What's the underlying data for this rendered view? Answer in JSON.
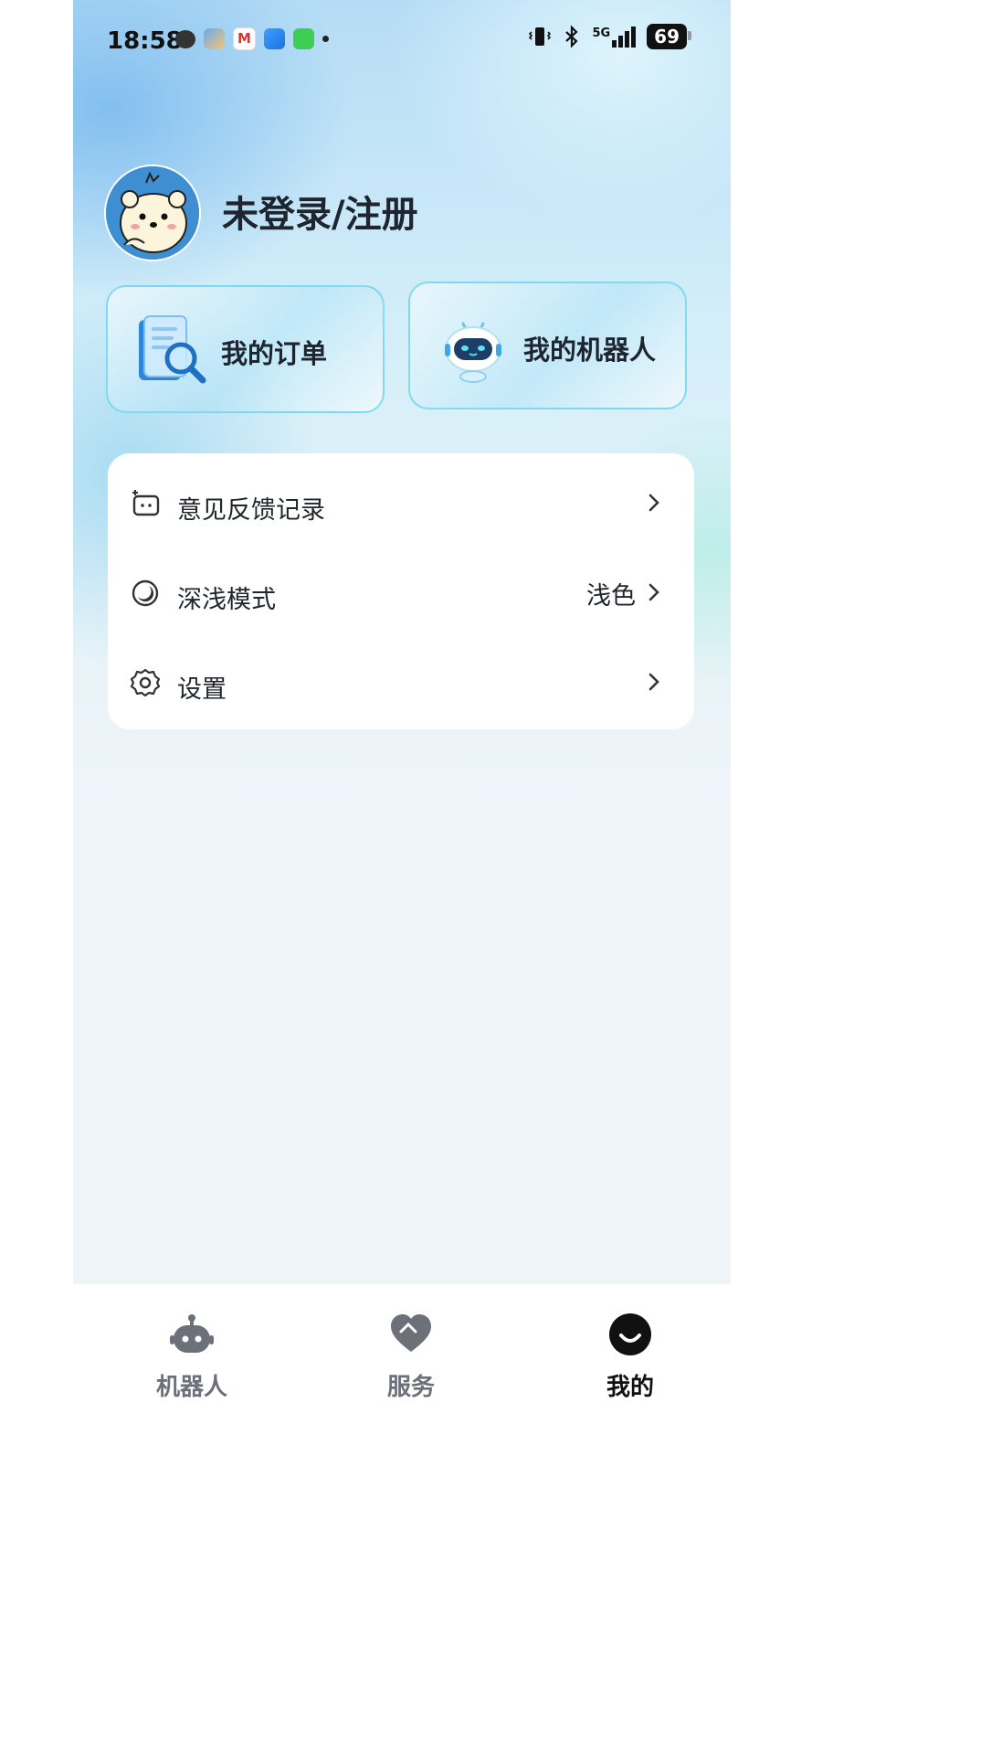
{
  "status_bar": {
    "time": "18:58",
    "network": "5G",
    "battery": "69",
    "notification_icons": [
      "wechat-icon",
      "weather-icon",
      "gmail-icon",
      "browser-icon",
      "messages-icon",
      "more-dot-icon"
    ],
    "system_icons": [
      "vibrate-icon",
      "bluetooth-icon",
      "signal-5g-icon",
      "battery-icon"
    ]
  },
  "profile": {
    "login_text": "未登录/注册",
    "avatar_icon": "bear-avatar-icon"
  },
  "quick_cards": [
    {
      "label": "我的订单",
      "icon": "document-search-icon"
    },
    {
      "label": "我的机器人",
      "icon": "robot-icon"
    }
  ],
  "menu": {
    "items": [
      {
        "label": "意见反馈记录",
        "icon": "feedback-icon",
        "value": ""
      },
      {
        "label": "深浅模式",
        "icon": "theme-mode-icon",
        "value": "浅色"
      },
      {
        "label": "设置",
        "icon": "gear-icon",
        "value": ""
      }
    ]
  },
  "tab_bar": {
    "tabs": [
      {
        "label": "机器人",
        "icon": "robot-tab-icon",
        "active": false
      },
      {
        "label": "服务",
        "icon": "heart-tab-icon",
        "active": false
      },
      {
        "label": "我的",
        "icon": "profile-tab-icon",
        "active": true
      }
    ]
  },
  "colors": {
    "accent_border": "#64d2eb",
    "text_primary": "#1e2530",
    "tab_inactive": "#6b7079",
    "tab_active": "#111111",
    "page_background": "#eff4f9"
  }
}
